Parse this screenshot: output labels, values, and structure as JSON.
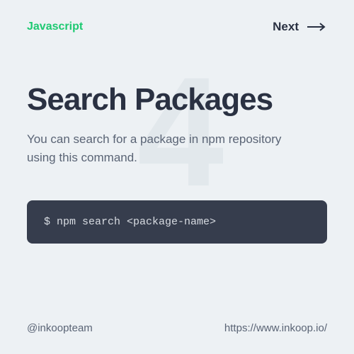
{
  "header": {
    "category": "Javascript",
    "next_label": "Next"
  },
  "main": {
    "bg_number": "4",
    "title": "Search Packages",
    "description": "You can search for a package in npm repository using this command.",
    "code": "$ npm search <package-name>"
  },
  "footer": {
    "handle": "@inkoopteam",
    "url": "https://www.inkoop.io/"
  }
}
